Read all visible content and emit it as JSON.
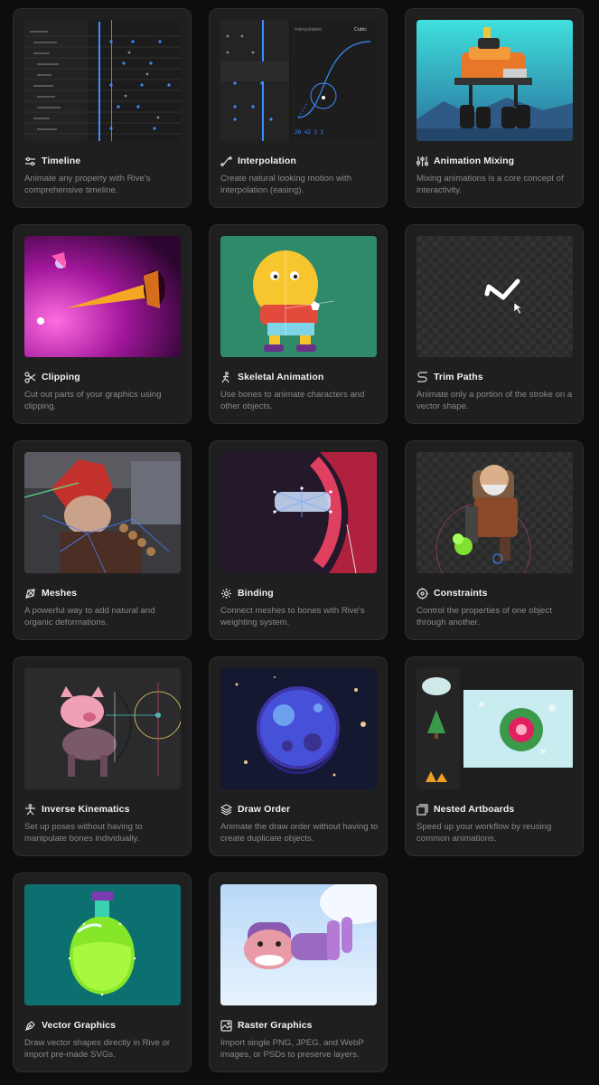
{
  "features": [
    {
      "title": "Timeline",
      "description": "Animate any property with Rive's comprehensive timeline.",
      "icon": "sliders-icon"
    },
    {
      "title": "Interpolation",
      "description": "Create natural looking motion with interpolation (easing).",
      "icon": "curve-icon"
    },
    {
      "title": "Animation Mixing",
      "description": "Mixing animations is a core concept of interactivity.",
      "icon": "mixer-icon"
    },
    {
      "title": "Clipping",
      "description": "Cut out parts of your graphics using clipping.",
      "icon": "scissors-icon"
    },
    {
      "title": "Skeletal Animation",
      "description": "Use bones to animate characters and other objects.",
      "icon": "running-figure-icon"
    },
    {
      "title": "Trim Paths",
      "description": "Animate only a portion of the stroke on a vector shape.",
      "icon": "path-icon"
    },
    {
      "title": "Meshes",
      "description": "A powerful way to add natural and organic deformations.",
      "icon": "mesh-icon"
    },
    {
      "title": "Binding",
      "description": "Connect meshes to bones with Rive's weighting system.",
      "icon": "binding-icon"
    },
    {
      "title": "Constraints",
      "description": "Control the properties of one object through another.",
      "icon": "crosshair-icon"
    },
    {
      "title": "Inverse Kinematics",
      "description": "Set up poses without having to manipulate bones individually.",
      "icon": "figure-icon"
    },
    {
      "title": "Draw Order",
      "description": "Animate the draw order without having to create duplicate objects.",
      "icon": "layers-icon"
    },
    {
      "title": "Nested Artboards",
      "description": "Speed up your workflow by reusing common animations.",
      "icon": "artboards-icon"
    },
    {
      "title": "Vector Graphics",
      "description": "Draw vector shapes directly in Rive or import pre-made SVGs.",
      "icon": "pen-tool-icon"
    },
    {
      "title": "Raster Graphics",
      "description": "Import single PNG, JPEG, and WebP images, or PSDs to preserve layers.",
      "icon": "image-icon"
    }
  ],
  "interpolation_panel": {
    "label": "Interpolation",
    "mode": "Cubic",
    "values": "26  42  2  1"
  },
  "colors": {
    "background": "#0d0d0d",
    "card": "#1f1f1f",
    "card_border": "#2e2e2e",
    "title": "#f2f2f2",
    "description": "#8a8a8a",
    "accent_blue": "#3d8bff"
  }
}
